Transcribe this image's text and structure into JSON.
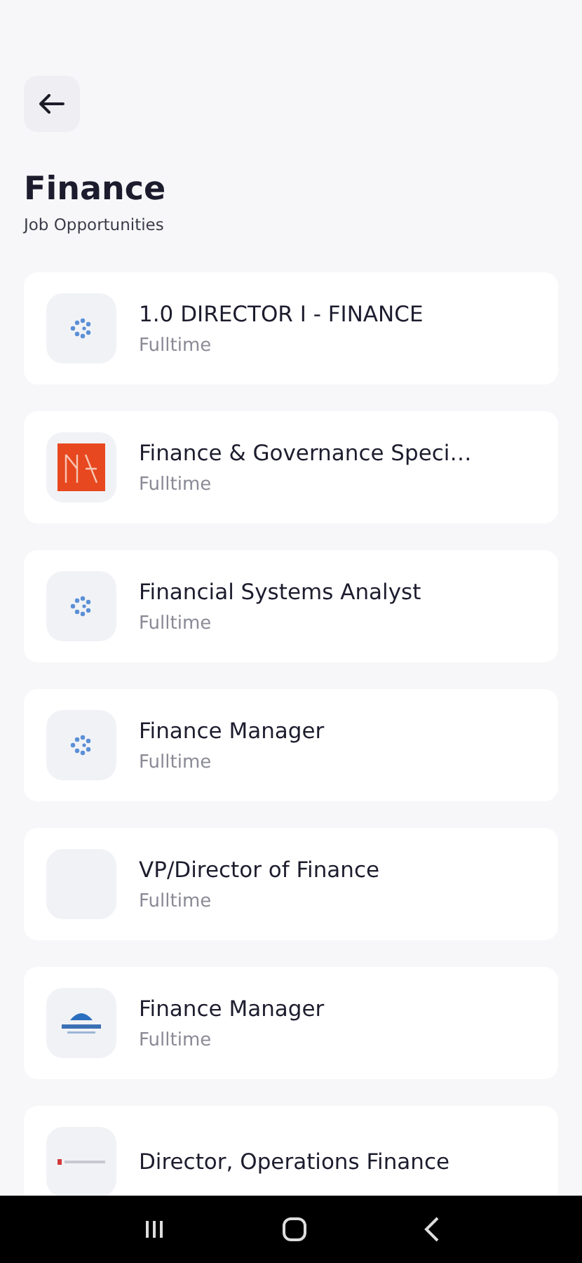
{
  "header": {
    "title": "Finance",
    "subtitle": "Job Opportunities"
  },
  "jobs": [
    {
      "title": "1.0 DIRECTOR I - FINANCE",
      "type": "Fulltime",
      "kind": "dots"
    },
    {
      "title": "Finance & Governance Speci…",
      "type": "Fulltime",
      "kind": "red"
    },
    {
      "title": "Financial Systems Analyst",
      "type": "Fulltime",
      "kind": "dots"
    },
    {
      "title": "Finance Manager",
      "type": "Fulltime",
      "kind": "dots"
    },
    {
      "title": "VP/Director of Finance",
      "type": "Fulltime",
      "kind": "blank"
    },
    {
      "title": "Finance Manager",
      "type": "Fulltime",
      "kind": "wave"
    },
    {
      "title": "Director, Operations Finance",
      "kind": "strip"
    }
  ]
}
